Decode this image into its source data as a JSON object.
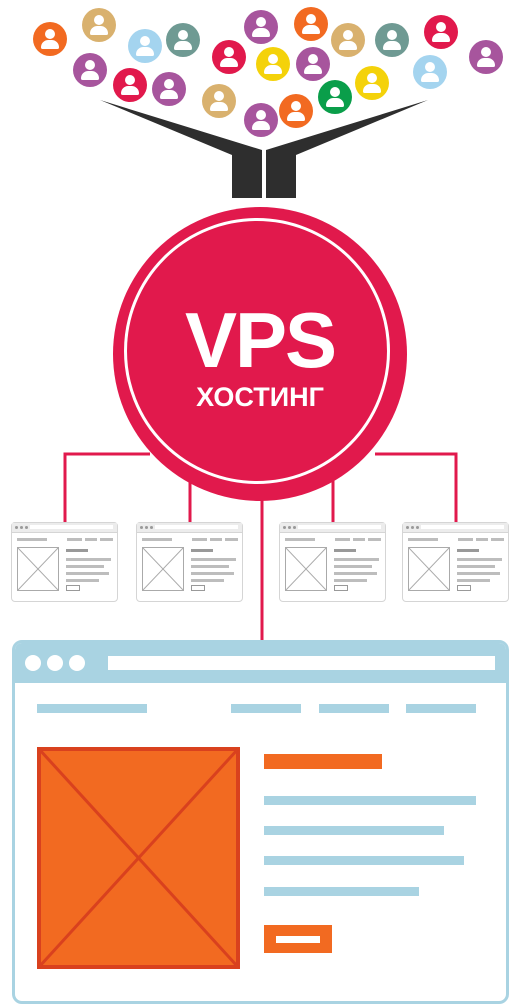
{
  "vps": {
    "title": "VPS",
    "subtitle": "ХОСТИНГ"
  },
  "colors": {
    "brand_red": "#e1194c",
    "funnel": "#2e2e2e",
    "accent_orange": "#f26a21",
    "accent_blue": "#a9d3e2"
  },
  "user_colors": [
    "#f26a21",
    "#d9b16e",
    "#a4d4ef",
    "#6f9a93",
    "#a7559d",
    "#e1194c",
    "#f4d20a",
    "#0a9e4a"
  ],
  "diagram": {
    "nodes": [
      "users",
      "vps-hosting",
      "site-1",
      "site-2",
      "site-3",
      "site-4",
      "site-main"
    ],
    "edges": [
      [
        "users",
        "vps-hosting"
      ],
      [
        "vps-hosting",
        "site-1"
      ],
      [
        "vps-hosting",
        "site-2"
      ],
      [
        "vps-hosting",
        "site-3"
      ],
      [
        "vps-hosting",
        "site-4"
      ],
      [
        "vps-hosting",
        "site-main"
      ]
    ]
  }
}
